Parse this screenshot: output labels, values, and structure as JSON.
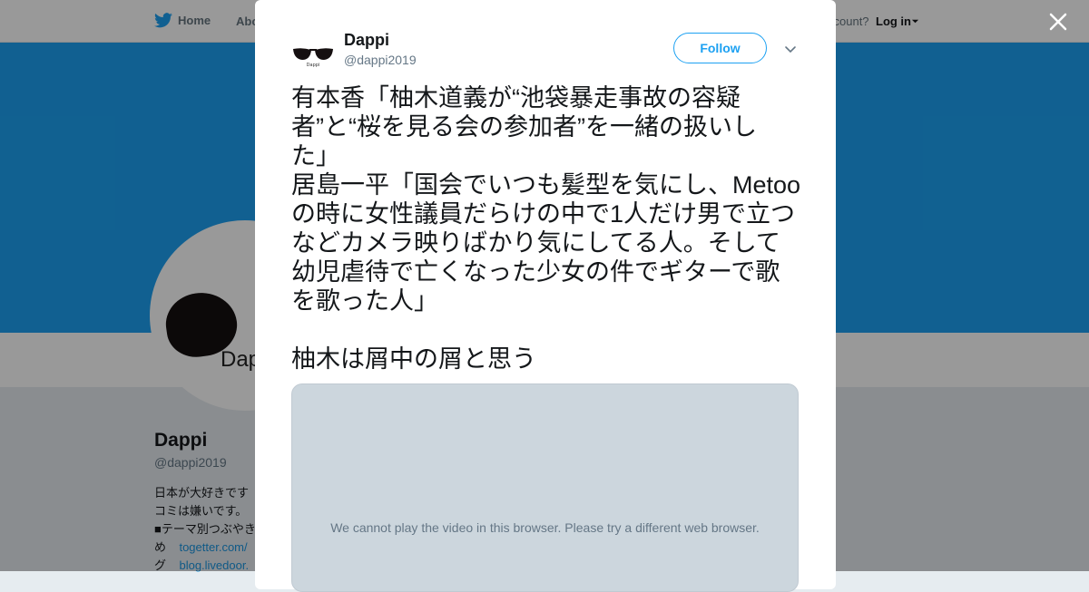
{
  "nav": {
    "home_label": "Home",
    "about_label": "Abo",
    "account_text": "ccount?",
    "login_label": "Log in"
  },
  "profile": {
    "name": "Dappi",
    "handle": "@dappi2019",
    "avatar_text": "Dap",
    "bio_lines": [
      "日本が大好きです",
      "コミは嫌いです。",
      "■テーマ別つぶやき",
      "め",
      "グ"
    ],
    "bio_links": [
      "togetter.com/",
      "blog.livedoor."
    ]
  },
  "modal": {
    "name": "Dappi",
    "handle": "@dappi2019",
    "avatar_text": "Dappi",
    "follow_label": "Follow",
    "tweet_text": "有本香「柚木道義が“池袋暴走事故の容疑者”と“桜を見る会の参加者”を一緒の扱いした」\n居島一平「国会でいつも髪型を気にし、Metooの時に女性議員だらけの中で1人だけ男で立つなどカメラ映りばかり気にしてる人。そして幼児虐待で亡くなった少女の件でギターで歌を歌った人」\n\n柚木は屑中の屑と思う",
    "media_message": "We cannot play the video in this browser. Please try a different web browser."
  },
  "colors": {
    "accent": "#1da1f2",
    "banner": "#1da1f2",
    "overlay": "rgba(0,0,0,0.4)"
  },
  "icons": [
    "twitter-bird-icon",
    "close-icon",
    "chevron-down-icon",
    "caret-down-icon"
  ]
}
